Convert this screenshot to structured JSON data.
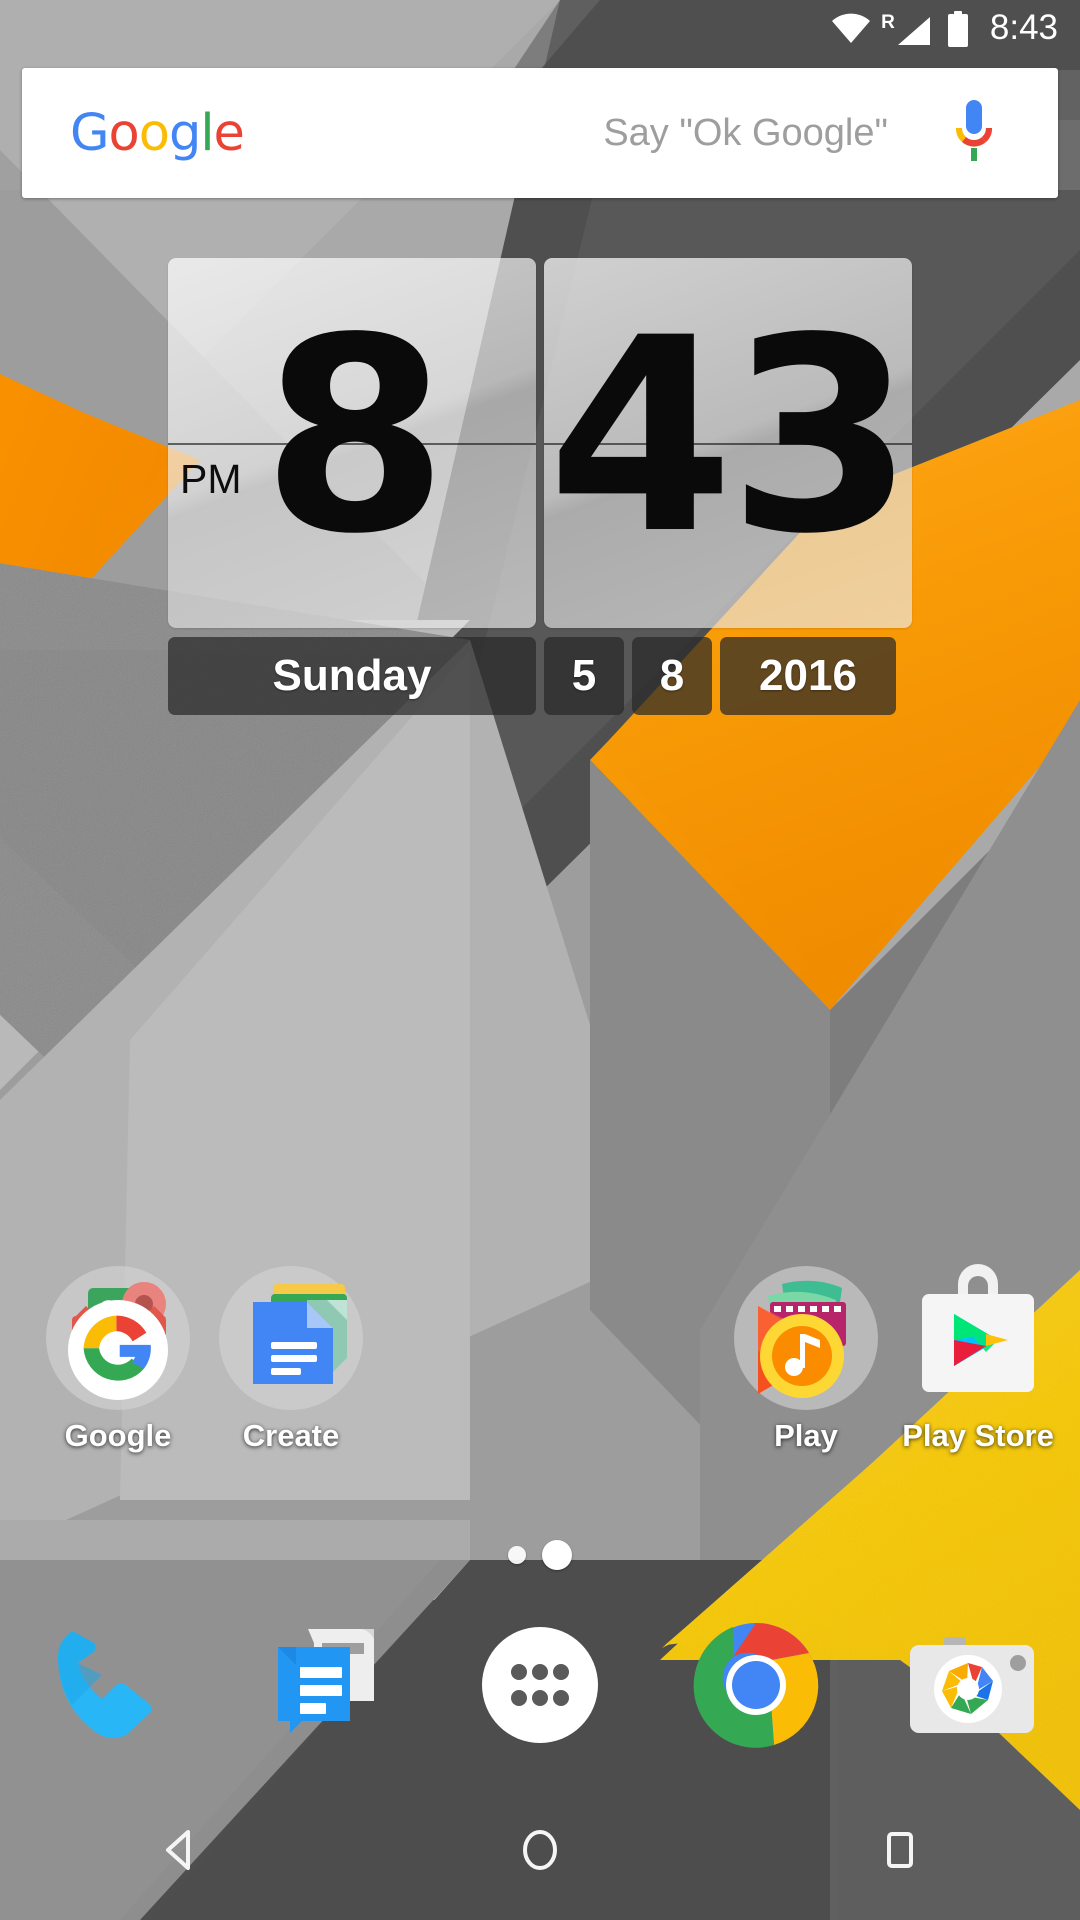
{
  "status_bar": {
    "wifi_icon": "wifi-full-icon",
    "roaming_letter": "R",
    "signal_icon": "cellular-signal-icon",
    "battery_icon": "battery-full-icon",
    "time": "8:43"
  },
  "search": {
    "logo_letters": [
      "G",
      "o",
      "o",
      "g",
      "l",
      "e"
    ],
    "placeholder": "Say \"Ok Google\"",
    "mic_icon": "microphone-icon"
  },
  "clock_widget": {
    "hour": "8",
    "minute": "43",
    "ampm": "PM",
    "day_name": "Sunday",
    "day_number": "5",
    "month_number": "8",
    "year": "2016"
  },
  "app_grid": [
    {
      "label": "Google",
      "icon": "google-folder-icon"
    },
    {
      "label": "Create",
      "icon": "google-docs-folder-icon"
    },
    {
      "label": "Play",
      "icon": "google-play-folder-icon"
    },
    {
      "label": "Play Store",
      "icon": "play-store-icon"
    }
  ],
  "page_indicator": {
    "count": 2,
    "active_index": 1
  },
  "dock": [
    {
      "label": "Phone",
      "icon": "phone-icon"
    },
    {
      "label": "Messenger",
      "icon": "messages-icon"
    },
    {
      "label": "All Apps",
      "icon": "app-drawer-icon"
    },
    {
      "label": "Chrome",
      "icon": "chrome-icon"
    },
    {
      "label": "Camera",
      "icon": "camera-icon"
    }
  ],
  "nav_bar": [
    {
      "label": "Back",
      "icon": "back-triangle-icon"
    },
    {
      "label": "Home",
      "icon": "home-circle-icon"
    },
    {
      "label": "Recents",
      "icon": "recents-square-icon"
    }
  ],
  "colors": {
    "google_blue": "#4285F4",
    "google_red": "#EA4335",
    "google_yellow": "#FBBC05",
    "google_green": "#34A853",
    "wallpaper_orange": "#F79A0B",
    "wallpaper_yellow": "#F5CA12",
    "dock_dark": "#4a4a4a"
  }
}
